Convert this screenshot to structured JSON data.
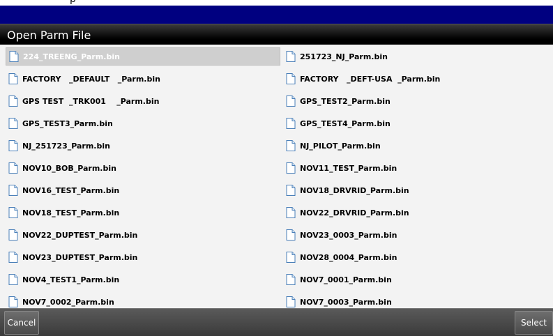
{
  "window": {
    "title": "Open Parm File",
    "top_text": "p"
  },
  "files": [
    {
      "name": "224_TREENG_Parm.bin",
      "selected": true
    },
    {
      "name": "251723_NJ_Parm.bin"
    },
    {
      "name": "FACTORY   _DEFAULT   _Parm.bin"
    },
    {
      "name": "FACTORY   _DEFT-USA  _Parm.bin"
    },
    {
      "name": "GPS TEST  _TRK001    _Parm.bin"
    },
    {
      "name": "GPS_TEST2_Parm.bin"
    },
    {
      "name": "GPS_TEST3_Parm.bin"
    },
    {
      "name": "GPS_TEST4_Parm.bin"
    },
    {
      "name": "NJ_251723_Parm.bin"
    },
    {
      "name": "NJ_PILOT_Parm.bin"
    },
    {
      "name": "NOV10_BOB_Parm.bin"
    },
    {
      "name": "NOV11_TEST_Parm.bin"
    },
    {
      "name": "NOV16_TEST_Parm.bin"
    },
    {
      "name": "NOV18_DRVRID_Parm.bin"
    },
    {
      "name": "NOV18_TEST_Parm.bin"
    },
    {
      "name": "NOV22_DRVRID_Parm.bin"
    },
    {
      "name": "NOV22_DUPTEST_Parm.bin"
    },
    {
      "name": "NOV23_0003_Parm.bin"
    },
    {
      "name": "NOV23_DUPTEST_Parm.bin"
    },
    {
      "name": "NOV28_0004_Parm.bin"
    },
    {
      "name": "NOV4_TEST1_Parm.bin"
    },
    {
      "name": "NOV7_0001_Parm.bin"
    },
    {
      "name": "NOV7_0002_Parm.bin"
    },
    {
      "name": "NOV7_0003_Parm.bin"
    }
  ],
  "footer": {
    "cancel_label": "Cancel",
    "select_label": "Select"
  },
  "colors": {
    "title_bar_top": "#000080",
    "selected_row": "#cfcfcf"
  },
  "icons": {
    "file": "document-icon"
  }
}
